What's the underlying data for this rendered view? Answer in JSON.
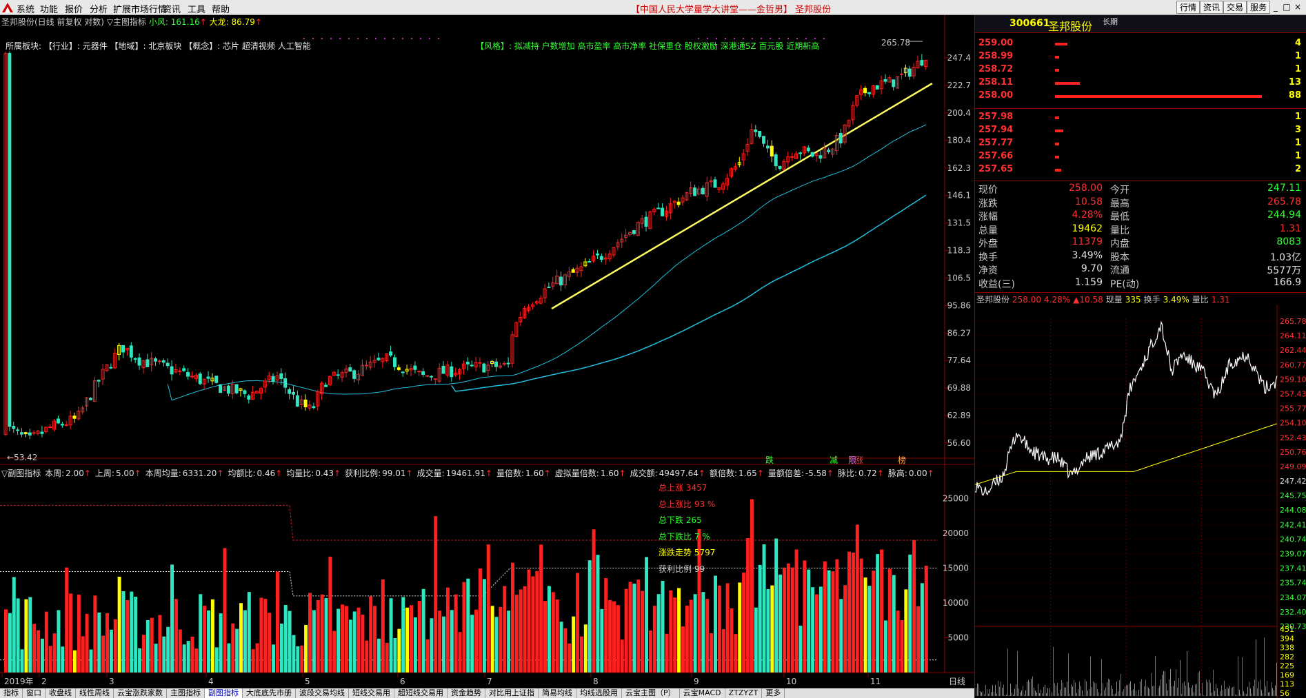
{
  "menubar": {
    "items": [
      "系统",
      "功能",
      "报价",
      "分析",
      "扩展市场行情",
      "资讯",
      "工具",
      "帮助"
    ],
    "center_title": "【中国人民大学量学大讲堂——金哲男】 圣邦股份",
    "right_buttons": [
      "行情",
      "资讯",
      "交易",
      "服务"
    ]
  },
  "main_chart": {
    "title": "圣邦股份(日线 前复权 对数)",
    "indicator_label": "▽主图指标",
    "xiaofeng_label": "小风:",
    "xiaofeng_value": "161.16",
    "dalong_label": "大龙:",
    "dalong_value": "86.79",
    "sector_line": "所属板块: 【行业】: 元器件 【地域】: 北京板块 【概念】: 芯片 超清视频 人工智能",
    "style_line": "【风格】: 拟减持 户数增加 高市盈率 高市净率 社保重仓 股权激励 深港通SZ 百元股 近期新高",
    "high_label": "265.78",
    "low_label": "53.42",
    "y_ticks": [
      "247.4",
      "222.7",
      "200.4",
      "180.4",
      "162.3",
      "146.1",
      "131.5",
      "118.3",
      "106.5",
      "95.86",
      "86.27",
      "77.64",
      "69.88",
      "62.89",
      "56.60"
    ],
    "markers": [
      "跌",
      "减",
      "限",
      "涨",
      "榜"
    ]
  },
  "sub_chart": {
    "header": [
      {
        "label": "▽副图指标",
        "value": ""
      },
      {
        "label": "本周:",
        "value": "2.00"
      },
      {
        "label": "上周:",
        "value": "5.00"
      },
      {
        "label": "本周均量:",
        "value": "6331.20"
      },
      {
        "label": "均额比:",
        "value": "0.46"
      },
      {
        "label": "均量比:",
        "value": "0.43"
      },
      {
        "label": "获利比例:",
        "value": "99.01"
      },
      {
        "label": "成交量:",
        "value": "19461.91"
      },
      {
        "label": "量倍数:",
        "value": "1.60"
      },
      {
        "label": "虚拟量倍数:",
        "value": "1.60"
      },
      {
        "label": "成交额:",
        "value": "49497.64"
      },
      {
        "label": "额倍数:",
        "value": "1.65"
      },
      {
        "label": "量额倍差:",
        "value": "-5.58"
      },
      {
        "label": "脉比:",
        "value": "0.72"
      },
      {
        "label": "脉高:",
        "value": "0.00"
      }
    ],
    "stats": [
      {
        "text": "总上涨 3457",
        "color": "#ff3030"
      },
      {
        "text": "总上涨比 93 %",
        "color": "#ff3030"
      },
      {
        "text": "总下跌 265",
        "color": "#30ff30"
      },
      {
        "text": "总下跌比 7 %",
        "color": "#30ff30"
      },
      {
        "text": "涨跌走势 5797",
        "color": "#ffff00"
      },
      {
        "text": "获利比例 99",
        "color": "#d0d0d0"
      }
    ],
    "y_ticks": [
      "25000",
      "20000",
      "15000",
      "10000",
      "5000"
    ]
  },
  "x_axis": {
    "labels": [
      "2019年",
      "2",
      "3",
      "4",
      "5",
      "6",
      "7",
      "8",
      "9",
      "10",
      "11"
    ],
    "period": "日线"
  },
  "tabs": [
    "指标",
    "窗口",
    "收盘线",
    "线性周线",
    "云宝涨跌家数",
    "主图指标",
    "副图指标",
    "大底底先市册",
    "波段交易均线",
    "短线交易用",
    "超短线交易用",
    "资金趋势",
    "对比用上证指",
    "简易均线",
    "均线选股用",
    "云宝主图（P）",
    "云宝MACD",
    "ZTZYZT",
    "更多"
  ],
  "tabs_active": 6,
  "right_panel": {
    "code": "300661",
    "name": "圣邦股份",
    "tag": "长期",
    "ask": [
      {
        "price": "259.00",
        "vol": "4",
        "bar": 0.06
      },
      {
        "price": "258.99",
        "vol": "1",
        "bar": 0.02
      },
      {
        "price": "258.72",
        "vol": "1",
        "bar": 0.02
      },
      {
        "price": "258.11",
        "vol": "13",
        "bar": 0.12
      },
      {
        "price": "258.00",
        "vol": "88",
        "bar": 1.0
      }
    ],
    "bid": [
      {
        "price": "257.98",
        "vol": "1",
        "bar": 0.02
      },
      {
        "price": "257.94",
        "vol": "3",
        "bar": 0.04
      },
      {
        "price": "257.77",
        "vol": "1",
        "bar": 0.02
      },
      {
        "price": "257.66",
        "vol": "1",
        "bar": 0.02
      },
      {
        "price": "257.65",
        "vol": "2",
        "bar": 0.03
      }
    ],
    "quotes": [
      {
        "l1": "现价",
        "v1": "258.00",
        "c1": "#ff3030",
        "l2": "今开",
        "v2": "247.11",
        "c2": "#30ff30"
      },
      {
        "l1": "涨跌",
        "v1": "10.58",
        "c1": "#ff3030",
        "l2": "最高",
        "v2": "265.78",
        "c2": "#ff3030"
      },
      {
        "l1": "涨幅",
        "v1": "4.28%",
        "c1": "#ff3030",
        "l2": "最低",
        "v2": "244.94",
        "c2": "#30ff30"
      },
      {
        "l1": "总量",
        "v1": "19462",
        "c1": "#ffff00",
        "l2": "量比",
        "v2": "1.31",
        "c2": "#ff3030"
      },
      {
        "l1": "外盘",
        "v1": "11379",
        "c1": "#ff3030",
        "l2": "内盘",
        "v2": "8083",
        "c2": "#30ff30"
      },
      {
        "l1": "换手",
        "v1": "3.49%",
        "c1": "#e0e0e0",
        "l2": "股本",
        "v2": "1.03亿",
        "c2": "#e0e0e0"
      },
      {
        "l1": "净资",
        "v1": "9.70",
        "c1": "#e0e0e0",
        "l2": "流通",
        "v2": "5577万",
        "c2": "#e0e0e0"
      },
      {
        "l1": "收益(三)",
        "v1": "1.159",
        "c1": "#e0e0e0",
        "l2": "PE(动)",
        "v2": "166.9",
        "c2": "#e0e0e0"
      }
    ],
    "intraday_header": [
      {
        "text": "圣邦股份",
        "color": "#c8c8c8"
      },
      {
        "text": "258.00",
        "color": "#ff3030"
      },
      {
        "text": "4.28%",
        "color": "#ff3030"
      },
      {
        "text": "▲10.58",
        "color": "#ff3030"
      },
      {
        "text": "现量",
        "color": "#c8c8c8"
      },
      {
        "text": "335",
        "color": "#ffff00"
      },
      {
        "text": "换手",
        "color": "#c8c8c8"
      },
      {
        "text": "3.49%",
        "color": "#ffff00"
      },
      {
        "text": "量比",
        "color": "#c8c8c8"
      },
      {
        "text": "1.31",
        "color": "#ff3030"
      }
    ],
    "price_ticks": [
      "265.78",
      "264.11",
      "262.44",
      "260.77",
      "259.10",
      "257.43",
      "255.77",
      "254.10",
      "252.43",
      "250.76",
      "249.09",
      "247.42",
      "245.75",
      "244.08",
      "242.41",
      "240.74",
      "239.07",
      "237.41",
      "235.74",
      "234.07",
      "232.40",
      "230.73"
    ],
    "vol_ticks": [
      "451",
      "394",
      "338",
      "282",
      "225",
      "169",
      "113",
      "56"
    ]
  },
  "colors": {
    "up": "#ff2020",
    "down": "#2ee6c0",
    "accent": "#ffff00",
    "ma": "#20c0e0"
  }
}
